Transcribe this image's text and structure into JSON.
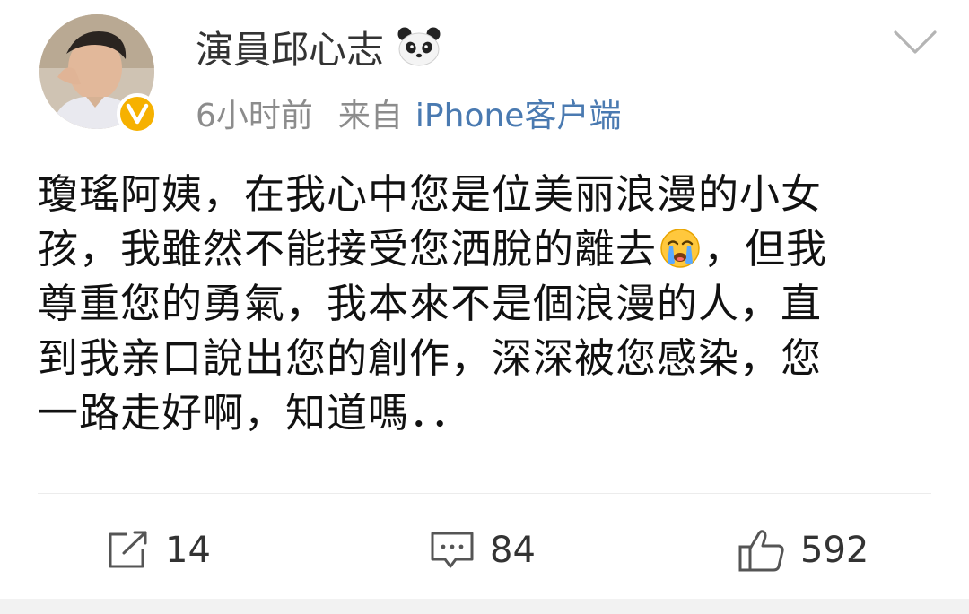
{
  "post": {
    "author": "演員邱心志",
    "author_badge_icon": "panda-emoji-icon",
    "verified_icon": "verified-v-icon",
    "time": "6小时前",
    "source_prefix": "来自",
    "source_device": "iPhone客户端",
    "text_lines": [
      "瓊瑤阿姨，在我心中您是位美丽浪漫的小女",
      "孩，我雖然不能接受您洒脫的離去",
      "，但我",
      "尊重您的勇氣，我本來不是個浪漫的人，直",
      "到我亲口說出您的創作，深深被您感染，您",
      "一路走好啊，知道嗎．．"
    ],
    "inline_emoji": "crying-face-icon"
  },
  "actions": {
    "repost_count": "14",
    "comment_count": "84",
    "like_count": "592"
  },
  "colors": {
    "link_blue": "#4a7ab1",
    "meta_gray": "#8c8c8c",
    "verified_gold": "#f6b100"
  }
}
